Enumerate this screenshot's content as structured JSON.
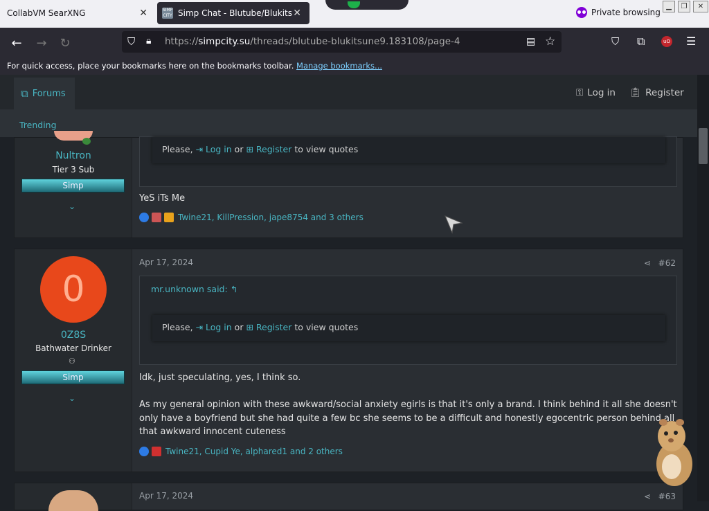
{
  "browser": {
    "tabs": [
      {
        "label": "CollabVM SearXNG"
      },
      {
        "label": "Simp Chat - Blutube/Blukitsune"
      }
    ],
    "private_label": "Private browsing",
    "url_domain": "simpcity.su",
    "url_prefix": "https://",
    "url_path": "/threads/blutube-blukitsune9.183108/page-4",
    "bookmarks_text": "For quick access, place your bookmarks here on the bookmarks toolbar.",
    "bookmarks_link": "Manage bookmarks...",
    "favicon_text": "SIMP CITY"
  },
  "site": {
    "forums_label": "Forums",
    "trending_label": "Trending",
    "login_label": "Log in",
    "register_label": "Register"
  },
  "posts": [
    {
      "username": "Nultron",
      "user_title": "Tier 3 Sub",
      "banner": "Simp",
      "quote_prefix": "Please,",
      "quote_login": "Log in",
      "quote_or": "or",
      "quote_register": "Register",
      "quote_suffix": "to view quotes",
      "text": "YeS iTs Me",
      "reactions": "Twine21, KillPression, jape8754 and 3 others"
    },
    {
      "avatar_letter": "0",
      "username": "0Z8S",
      "user_title": "Bathwater Drinker",
      "banner": "Simp",
      "date": "Apr 17, 2024",
      "number": "#62",
      "quote_author": "mr.unknown said:",
      "quote_prefix": "Please,",
      "quote_login": "Log in",
      "quote_or": "or",
      "quote_register": "Register",
      "quote_suffix": "to view quotes",
      "text1": "Idk, just speculating, yes, I think so.",
      "text2": "As my general opinion with these awkward/social anxiety egirls is that it's only a brand. I think behind it all she doesn't only have a boyfriend but she had quite a few bc she seems to be a difficult and honestly egocentric person behind all that awkward innocent cuteness",
      "reactions": "Twine21, Cupid Ye, alphared1 and 2 others"
    },
    {
      "date": "Apr 17, 2024",
      "number": "#63"
    }
  ],
  "colors": {
    "accent": "#49b5c2",
    "banner_top": "#5fd2dc",
    "avatar_bg": "#e8481b"
  }
}
